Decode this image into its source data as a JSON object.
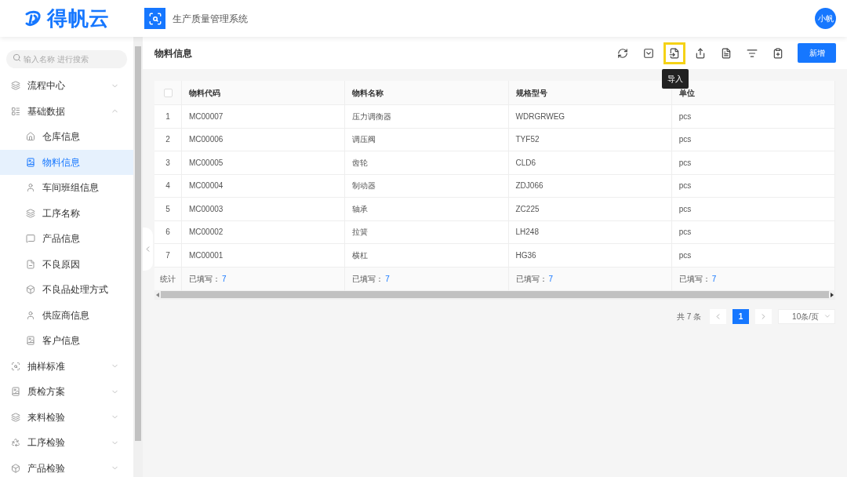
{
  "header": {
    "logo": "得帆云",
    "app_title": "生产质量管理系统",
    "avatar": "小帆"
  },
  "sidebar": {
    "search": {
      "placeholder": "输入名称 进行搜索"
    },
    "items": [
      {
        "label": "流程中心",
        "expanded": false
      },
      {
        "label": "基础数据",
        "expanded": true,
        "children": [
          {
            "label": "仓库信息",
            "selected": false
          },
          {
            "label": "物料信息",
            "selected": true
          },
          {
            "label": "车间班组信息",
            "selected": false
          },
          {
            "label": "工序名称",
            "selected": false
          },
          {
            "label": "产品信息",
            "selected": false
          },
          {
            "label": "不良原因",
            "selected": false
          },
          {
            "label": "不良品处理方式",
            "selected": false
          },
          {
            "label": "供应商信息",
            "selected": false
          },
          {
            "label": "客户信息",
            "selected": false
          }
        ]
      },
      {
        "label": "抽样标准",
        "expanded": false
      },
      {
        "label": "质检方案",
        "expanded": false
      },
      {
        "label": "来料检验",
        "expanded": false
      },
      {
        "label": "工序检验",
        "expanded": false
      },
      {
        "label": "产品检验",
        "expanded": false
      }
    ]
  },
  "page": {
    "title": "物料信息",
    "primary_button": "新增",
    "toolbar": [
      {
        "highlighted": false
      },
      {
        "highlighted": false
      },
      {
        "highlighted": true,
        "tooltip": "导入"
      },
      {
        "highlighted": false
      },
      {
        "highlighted": false
      },
      {
        "highlighted": false
      },
      {
        "highlighted": false
      }
    ]
  },
  "table": {
    "select_all": {
      "checked": false
    },
    "columns": [
      "",
      "物料代码",
      "物料名称",
      "规格型号",
      "单位"
    ],
    "rows": [
      [
        "1",
        "MC00007",
        "压力调衡器",
        "WDRGRWEG",
        "pcs"
      ],
      [
        "2",
        "MC00006",
        "调压阀",
        "TYF52",
        "pcs"
      ],
      [
        "3",
        "MC00005",
        "齿轮",
        "CLD6",
        "pcs"
      ],
      [
        "4",
        "MC00004",
        "制动器",
        "ZDJ066",
        "pcs"
      ],
      [
        "5",
        "MC00003",
        "轴承",
        "ZC225",
        "pcs"
      ],
      [
        "6",
        "MC00002",
        "拉簧",
        "LH248",
        "pcs"
      ],
      [
        "7",
        "MC00001",
        "横杠",
        "HG36",
        "pcs"
      ]
    ],
    "summary": {
      "label": "统计",
      "cells": [
        {
          "text": "已填写：",
          "count": "7"
        },
        {
          "text": "已填写：",
          "count": "7"
        },
        {
          "text": "已填写：",
          "count": "7"
        },
        {
          "text": "已填写：",
          "count": "7"
        }
      ]
    }
  },
  "pagination": {
    "total": "共 7 条",
    "pages": [
      {
        "label": "1",
        "selected": true
      }
    ],
    "page_size": "10条/页"
  }
}
